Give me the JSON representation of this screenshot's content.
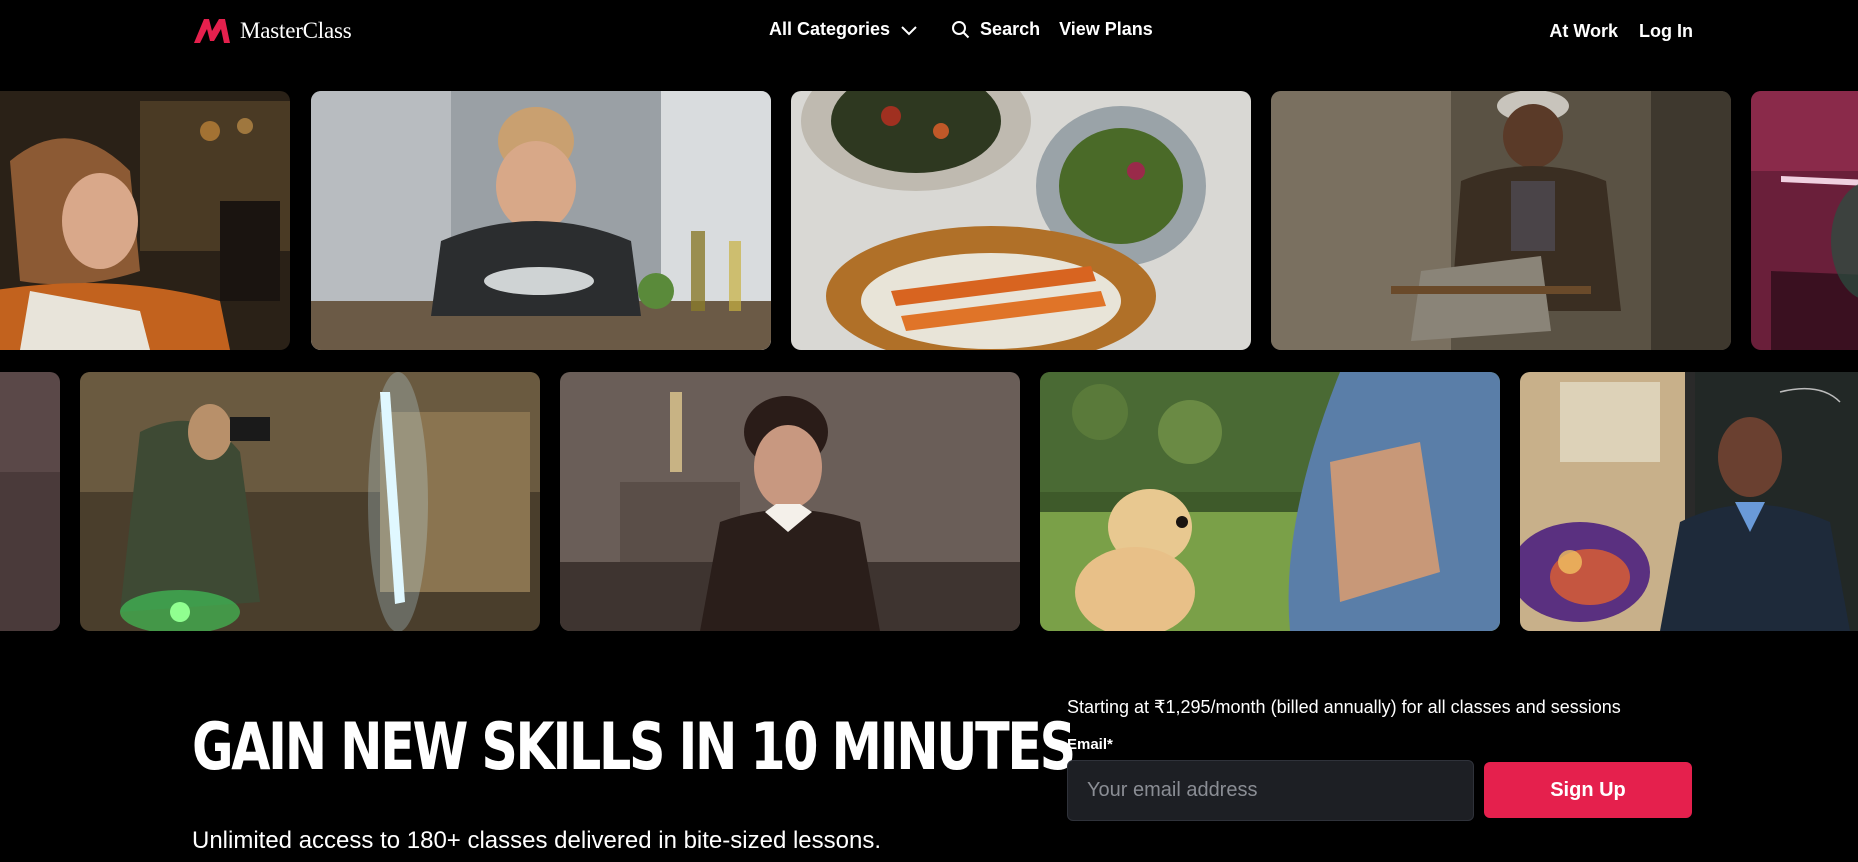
{
  "header": {
    "brand": "MasterClass",
    "brand_color": "#e5204d",
    "nav": {
      "categories_label": "All Categories",
      "search_label": "Search",
      "plans_label": "View Plans"
    },
    "right": {
      "work_label": "At Work",
      "login_label": "Log In"
    }
  },
  "gallery": {
    "row1": [
      "woman-reading-letter",
      "chef-holding-plate",
      "vegetable-dishes",
      "man-seated-in-cap",
      "partial-pink-scene"
    ],
    "row2": [
      "partial-dim-scene",
      "photographer-with-light-tube",
      "woman-in-living-room",
      "puppy-training",
      "scientist-with-chalkboard"
    ]
  },
  "hero": {
    "headline": "GAIN NEW SKILLS IN 10 MINUTES",
    "subline": "Unlimited access to 180+ classes delivered in bite-sized lessons."
  },
  "signup": {
    "pricing": "Starting at ₹1,295/month (billed annually) for all classes and sessions",
    "email_label": "Email*",
    "email_placeholder": "Your email address",
    "email_value": "",
    "button_label": "Sign Up"
  }
}
